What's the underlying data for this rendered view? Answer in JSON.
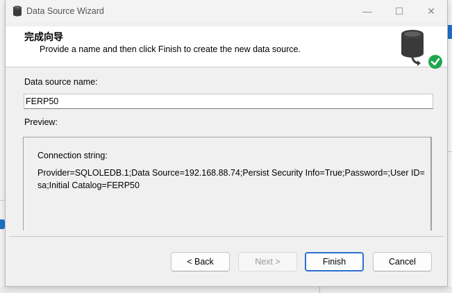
{
  "window": {
    "title": "Data Source Wizard",
    "minimize_glyph": "—",
    "maximize_glyph": "☐",
    "close_glyph": "✕"
  },
  "header": {
    "title": "完成向导",
    "subtitle": "Provide a name and then click Finish to create the new data source.",
    "graphic_icon": "database-check-icon"
  },
  "form": {
    "name_label": "Data source name:",
    "name_value": "FERP50",
    "preview_label": "Preview:",
    "connection_label": "Connection string:",
    "connection_string": "Provider=SQLOLEDB.1;Data Source=192.168.88.74;Persist Security Info=True;Password=;User ID=sa;Initial Catalog=FERP50"
  },
  "buttons": {
    "back": "< Back",
    "next": "Next >",
    "finish": "Finish",
    "cancel": "Cancel"
  },
  "colors": {
    "accent": "#2a6fd0",
    "check_green": "#1fa650",
    "header_bg": "#ffffff",
    "dialog_bg": "#f0f0f0"
  }
}
